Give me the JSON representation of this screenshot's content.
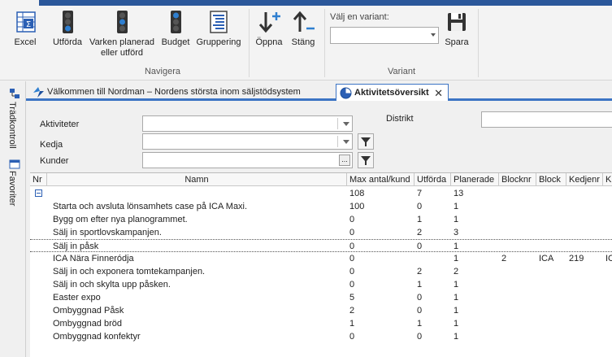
{
  "ribbon": {
    "buttons": {
      "excel": "Excel",
      "utforda": "Utförda",
      "varken_line1": "Varken planerad",
      "varken_line2": "eller utförd",
      "budget": "Budget",
      "gruppering": "Gruppering",
      "oppna": "Öppna",
      "stang": "Stäng",
      "spara": "Spara"
    },
    "groups": {
      "navigera": "Navigera",
      "variant": "Variant"
    },
    "variant_label": "Välj en variant:",
    "variant_value": ""
  },
  "side_panel": {
    "tradkontroll": "Trädkontroll",
    "favoriter": "Favoriter"
  },
  "tabs": [
    {
      "label": "Välkommen till Nordman – Nordens största inom säljstödsystem",
      "active": false
    },
    {
      "label": "Aktivitetsöversikt",
      "active": true
    }
  ],
  "filters": {
    "aktiviteter_label": "Aktiviteter",
    "kedja_label": "Kedja",
    "kunder_label": "Kunder",
    "distrikt_label": "Distrikt",
    "aktiviteter_value": "",
    "kedja_value": "",
    "kunder_value": "",
    "distrikt_value": ""
  },
  "grid": {
    "columns": [
      "Nr",
      "Namn",
      "Max antal/kund",
      "Utförda",
      "Planerade",
      "Blocknr",
      "Block",
      "Kedjenr",
      "K"
    ],
    "summary": {
      "max": "108",
      "utforda": "7",
      "planerade": "13"
    },
    "rows": [
      {
        "namn": "Starta och avsluta lönsamhets case på ICA Maxi.",
        "max": "100",
        "utforda": "0",
        "planerade": "1",
        "blocknr": "",
        "block": "",
        "kedjenr": "",
        "k": ""
      },
      {
        "namn": "Bygg om efter nya planogrammet.",
        "max": "0",
        "utforda": "1",
        "planerade": "1",
        "blocknr": "",
        "block": "",
        "kedjenr": "",
        "k": ""
      },
      {
        "namn": "Sälj in sportlovskampanjen.",
        "max": "0",
        "utforda": "2",
        "planerade": "3",
        "blocknr": "",
        "block": "",
        "kedjenr": "",
        "k": ""
      },
      {
        "namn": "Sälj in påsk",
        "max": "0",
        "utforda": "0",
        "planerade": "1",
        "blocknr": "",
        "block": "",
        "kedjenr": "",
        "k": ""
      },
      {
        "namn": "ICA Nära Finneródja",
        "max": "0",
        "utforda": "",
        "planerade": "1",
        "blocknr": "2",
        "block": "ICA",
        "kedjenr": "219",
        "k": "IC"
      },
      {
        "namn": "Sälj in och exponera tomtekampanjen.",
        "max": "0",
        "utforda": "2",
        "planerade": "2",
        "blocknr": "",
        "block": "",
        "kedjenr": "",
        "k": ""
      },
      {
        "namn": "Sälj in och skylta upp påsken.",
        "max": "0",
        "utforda": "1",
        "planerade": "1",
        "blocknr": "",
        "block": "",
        "kedjenr": "",
        "k": ""
      },
      {
        "namn": "Easter expo",
        "max": "5",
        "utforda": "0",
        "planerade": "1",
        "blocknr": "",
        "block": "",
        "kedjenr": "",
        "k": ""
      },
      {
        "namn": "Ombyggnad Påsk",
        "max": "2",
        "utforda": "0",
        "planerade": "1",
        "blocknr": "",
        "block": "",
        "kedjenr": "",
        "k": ""
      },
      {
        "namn": "Ombyggnad bröd",
        "max": "1",
        "utforda": "1",
        "planerade": "1",
        "blocknr": "",
        "block": "",
        "kedjenr": "",
        "k": ""
      },
      {
        "namn": "Ombyggnad konfektyr",
        "max": "0",
        "utforda": "0",
        "planerade": "1",
        "blocknr": "",
        "block": "",
        "kedjenr": "",
        "k": ""
      }
    ]
  },
  "colors": {
    "ribbon_accent": "#2b579a",
    "tab_accent": "#3c74c4",
    "icon_blue": "#1e73be"
  }
}
